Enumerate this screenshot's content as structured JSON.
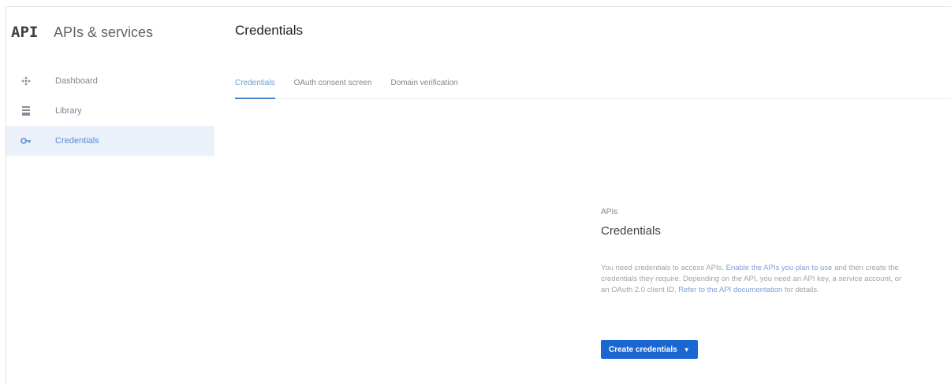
{
  "sidebar": {
    "logo": "API",
    "title": "APIs & services",
    "items": [
      {
        "label": "Dashboard",
        "icon": "dashboard-icon",
        "active": false
      },
      {
        "label": "Library",
        "icon": "library-icon",
        "active": false
      },
      {
        "label": "Credentials",
        "icon": "key-icon",
        "active": true
      }
    ]
  },
  "header": {
    "title": "Credentials",
    "tabs": [
      {
        "label": "Credentials",
        "active": true
      },
      {
        "label": "OAuth consent screen",
        "active": false
      },
      {
        "label": "Domain verification",
        "active": false
      }
    ]
  },
  "empty_state": {
    "eyebrow": "APIs",
    "title": "Credentials",
    "desc_1": "You need credentials to access APIs. ",
    "link_1": "Enable the APIs you plan to use",
    "desc_2": " and then create the credentials they require. Depending on the API, you need an API key, a service account, or an OAuth 2.0 client ID. ",
    "link_2": "Refer to the API documentation",
    "desc_3": " for details.",
    "button_label": "Create credentials"
  },
  "colors": {
    "accent": "#1a66d2",
    "active_bg": "#eaf1fb",
    "link": "#7fa0d8"
  }
}
